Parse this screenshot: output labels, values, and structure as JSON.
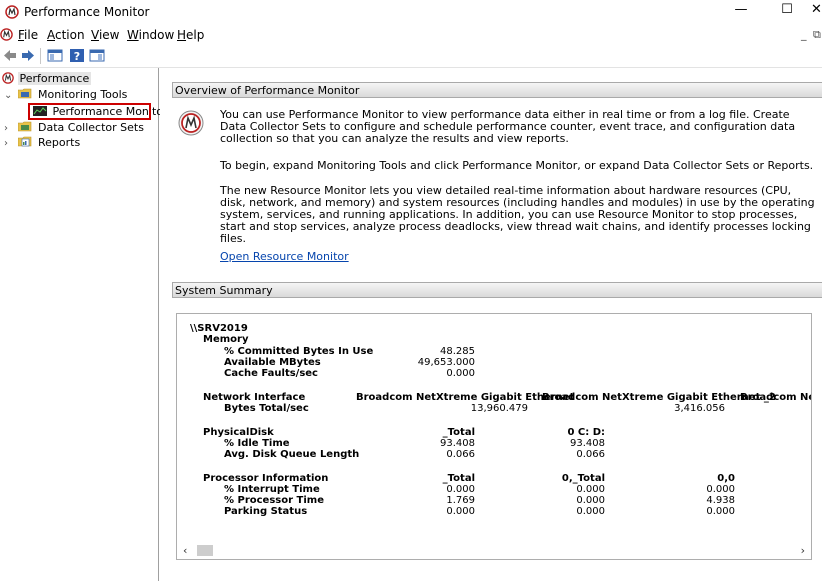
{
  "window": {
    "title": "Performance Monitor",
    "minimize": "—",
    "maximize": "☐",
    "close": "✕"
  },
  "menu": {
    "items": [
      "File",
      "Action",
      "View",
      "Window",
      "Help"
    ],
    "underline": [
      "F",
      "A",
      "V",
      "W",
      "H"
    ],
    "mdi_min": "_",
    "mdi_restore": "⧉"
  },
  "tree": {
    "root": "Performance",
    "monitoring_tools": "Monitoring Tools",
    "performance_monitor": "Performance Monitor",
    "data_collector_sets": "Data Collector Sets",
    "reports": "Reports"
  },
  "overview": {
    "header": "Overview of Performance Monitor",
    "p1": "You can use Performance Monitor to view performance data either in real time or from a log file. Create Data Collector Sets to configure and schedule performance counter, event trace, and configuration data collection so that you can analyze the results and view reports.",
    "p2": "To begin, expand Monitoring Tools and click Performance Monitor, or expand Data Collector Sets or Reports.",
    "p3": "The new Resource Monitor lets you view detailed real-time information about hardware resources (CPU, disk, network, and memory) and system resources (including handles and modules) in use by the operating system, services, and running applications. In addition, you can use Resource Monitor to stop processes, start and stop services, analyze process deadlocks, view thread wait chains, and identify processes locking files.",
    "link": "Open Resource Monitor"
  },
  "summary": {
    "header": "System Summary",
    "server": "\\\\SRV2019",
    "memory": {
      "label": "Memory",
      "rows": [
        {
          "name": "% Committed Bytes In Use",
          "value": "48.285"
        },
        {
          "name": "Available MBytes",
          "value": "49,653.000"
        },
        {
          "name": "Cache Faults/sec",
          "value": "0.000"
        }
      ]
    },
    "network": {
      "label": "Network Interface",
      "cols": [
        "Broadcom NetXtreme Gigabit Ethernet",
        "Broadcom NetXtreme Gigabit Ethernet _2",
        "Broadcom NetX"
      ],
      "row_name": "Bytes Total/sec",
      "values": [
        "13,960.479",
        "3,416.056"
      ]
    },
    "disk": {
      "label": "PhysicalDisk",
      "cols": [
        "_Total",
        "0 C: D:"
      ],
      "rows": [
        {
          "name": "% Idle Time",
          "values": [
            "93.408",
            "93.408"
          ]
        },
        {
          "name": "Avg. Disk Queue Length",
          "values": [
            "0.066",
            "0.066"
          ]
        }
      ]
    },
    "processor": {
      "label": "Processor Information",
      "cols": [
        "_Total",
        "0,_Total",
        "0,0"
      ],
      "rows": [
        {
          "name": "% Interrupt Time",
          "values": [
            "0.000",
            "0.000",
            "0.000"
          ]
        },
        {
          "name": "% Processor Time",
          "values": [
            "1.769",
            "0.000",
            "4.938"
          ]
        },
        {
          "name": "Parking Status",
          "values": [
            "0.000",
            "0.000",
            "0.000"
          ]
        }
      ]
    }
  }
}
